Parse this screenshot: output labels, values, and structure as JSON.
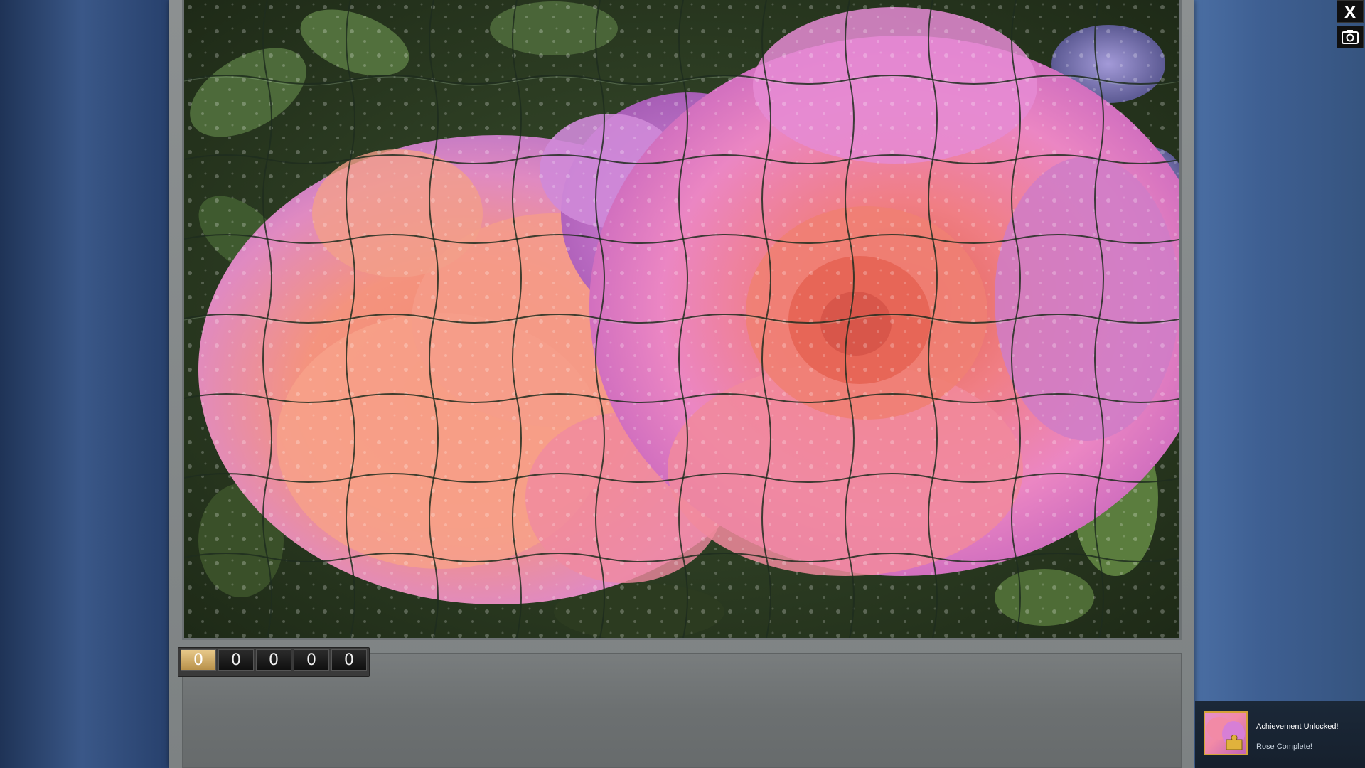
{
  "window": {
    "close_label": "X",
    "close_icon": "close-icon",
    "screenshot_icon": "camera-icon"
  },
  "puzzle": {
    "image_subject": "pink and peach roses with water droplets",
    "rows": 8,
    "cols": 12
  },
  "counter": {
    "digits": [
      "0",
      "0",
      "0",
      "0",
      "0"
    ]
  },
  "toast": {
    "title": "Achievement Unlocked!",
    "subtitle": "Rose Complete!",
    "border_color": "#d4a237"
  }
}
